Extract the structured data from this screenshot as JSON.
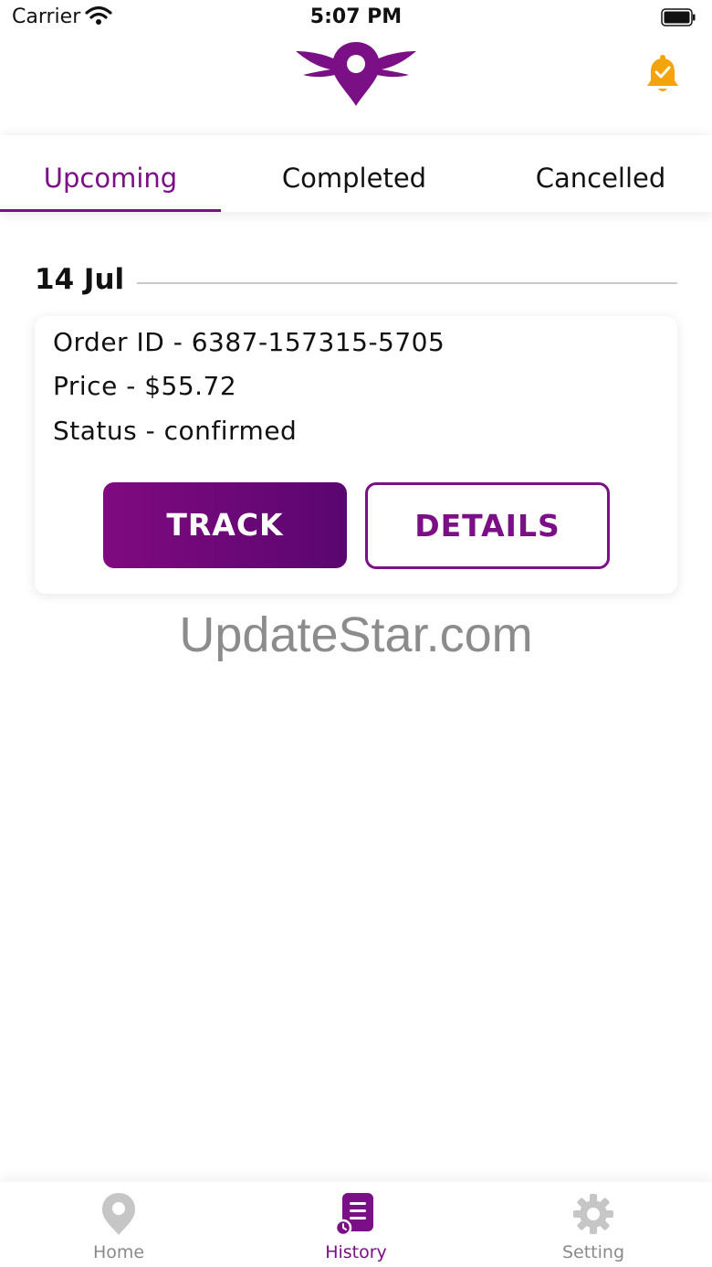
{
  "status_bar": {
    "carrier": "Carrier",
    "time": "5:07 PM"
  },
  "colors": {
    "accent": "#7b0f86",
    "bell": "#f5a30a",
    "inactive": "#8a8a8a"
  },
  "header": {
    "logo_icon": "winged-location-pin-icon",
    "notification_icon": "bell-check-icon"
  },
  "tabs": [
    {
      "label": "Upcoming",
      "active": true
    },
    {
      "label": "Completed",
      "active": false
    },
    {
      "label": "Cancelled",
      "active": false
    }
  ],
  "orders": {
    "date": "14 Jul",
    "order_id": "Order ID - 6387-157315-5705",
    "price": "Price - $55.72",
    "status": "Status - confirmed",
    "track_label": "TRACK",
    "details_label": "DETAILS"
  },
  "watermark": "UpdateStar.com",
  "bottom_nav": [
    {
      "label": "Home",
      "icon": "location-pin-icon",
      "active": false
    },
    {
      "label": "History",
      "icon": "history-list-icon",
      "active": true
    },
    {
      "label": "Setting",
      "icon": "gear-icon",
      "active": false
    }
  ]
}
